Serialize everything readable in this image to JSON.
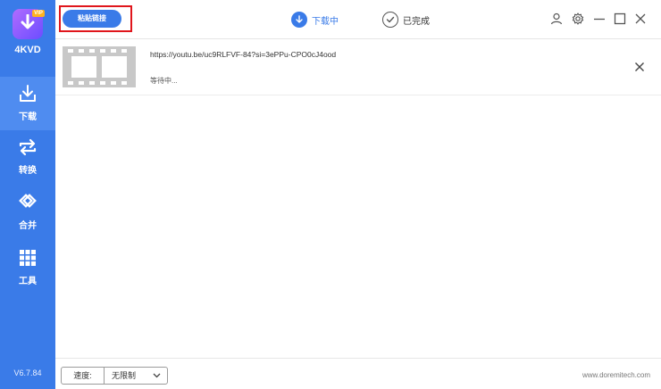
{
  "app": {
    "name": "4KVD",
    "version": "V6.7.84",
    "badge": "VIP"
  },
  "colors": {
    "accent": "#3a7be8",
    "highlight": "#e0161c",
    "logo": "#8a5cff"
  },
  "sidebar": {
    "items": [
      {
        "label": "下载",
        "icon": "download-icon",
        "active": true
      },
      {
        "label": "转换",
        "icon": "convert-icon",
        "active": false
      },
      {
        "label": "合并",
        "icon": "merge-icon",
        "active": false
      },
      {
        "label": "工具",
        "icon": "tools-icon",
        "active": false
      }
    ]
  },
  "toolbar": {
    "paste_label": "粘贴链接",
    "tabs": [
      {
        "label": "下载中",
        "icon": "download-circle-icon",
        "active": true
      },
      {
        "label": "已完成",
        "icon": "check-circle-icon",
        "active": false
      }
    ],
    "window_icons": [
      "user-icon",
      "gear-icon",
      "minimize-icon",
      "maximize-icon",
      "close-icon"
    ]
  },
  "downloads": [
    {
      "url": "https://youtu.be/uc9RLFVF-84?si=3ePPu-CPO0cJ4ood",
      "status": "等待中..."
    }
  ],
  "footer": {
    "speed_label": "速度:",
    "speed_value": "无限制",
    "website": "www.doremitech.com"
  }
}
